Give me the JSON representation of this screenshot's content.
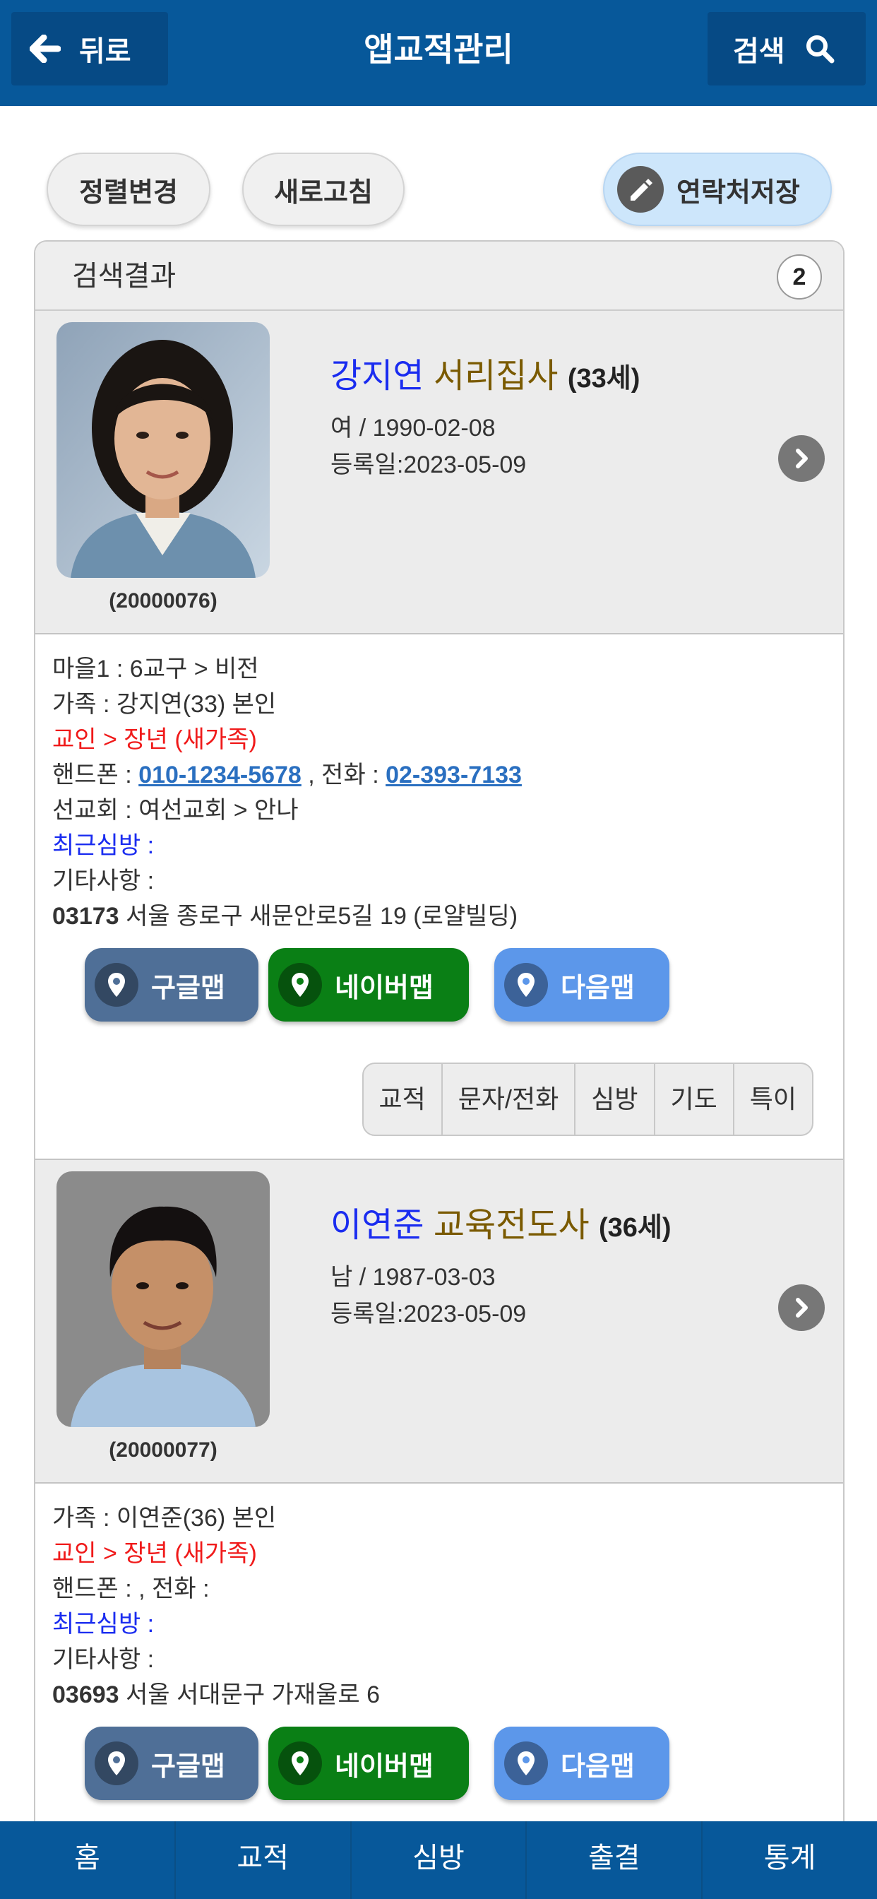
{
  "header": {
    "back_label": "뒤로",
    "title": "앱교적관리",
    "search_label": "검색"
  },
  "toolbar": {
    "sort_label": "정렬변경",
    "refresh_label": "새로고침",
    "save_contacts_label": "연락처저장"
  },
  "results": {
    "title": "검색결과",
    "count": "2"
  },
  "members": [
    {
      "name": "강지연",
      "rank": "서리집사",
      "age": "(33세)",
      "gender_birth": "여 / 1990-02-08",
      "registered": "등록일:2023-05-09",
      "id": "(20000076)",
      "village": "마을1 : 6교구 > 비전",
      "family": "가족 : 강지연(33) 본인",
      "church_status": "교인 > 장년 (새가족)",
      "phone_prefix": "핸드폰 : ",
      "phone": "010-1234-5678",
      "tel_prefix": " , 전화 : ",
      "tel": "02-393-7133",
      "mission": "선교회 : 여선교회 > 안나",
      "recent_visit": "최근심방 :",
      "notes": "기타사항 :",
      "zip": "03173",
      "address": " 서울 종로구 새문안로5길 19 (로얄빌딩)"
    },
    {
      "name": "이연준",
      "rank": "교육전도사",
      "age": "(36세)",
      "gender_birth": "남 / 1987-03-03",
      "registered": "등록일:2023-05-09",
      "id": "(20000077)",
      "family": "가족 : 이연준(36) 본인",
      "church_status": "교인 > 장년 (새가족)",
      "phone_line": "핸드폰 : , 전화 :",
      "recent_visit": "최근심방 :",
      "notes": "기타사항 :",
      "zip": "03693",
      "address": " 서울 서대문구 가재울로 6"
    }
  ],
  "map_buttons": {
    "google": "구글맵",
    "naver": "네이버맵",
    "daum": "다음맵"
  },
  "detail_tabs": [
    "교적",
    "문자/전화",
    "심방",
    "기도",
    "특이"
  ],
  "bottom_nav": [
    "홈",
    "교적",
    "심방",
    "출결",
    "통계"
  ]
}
